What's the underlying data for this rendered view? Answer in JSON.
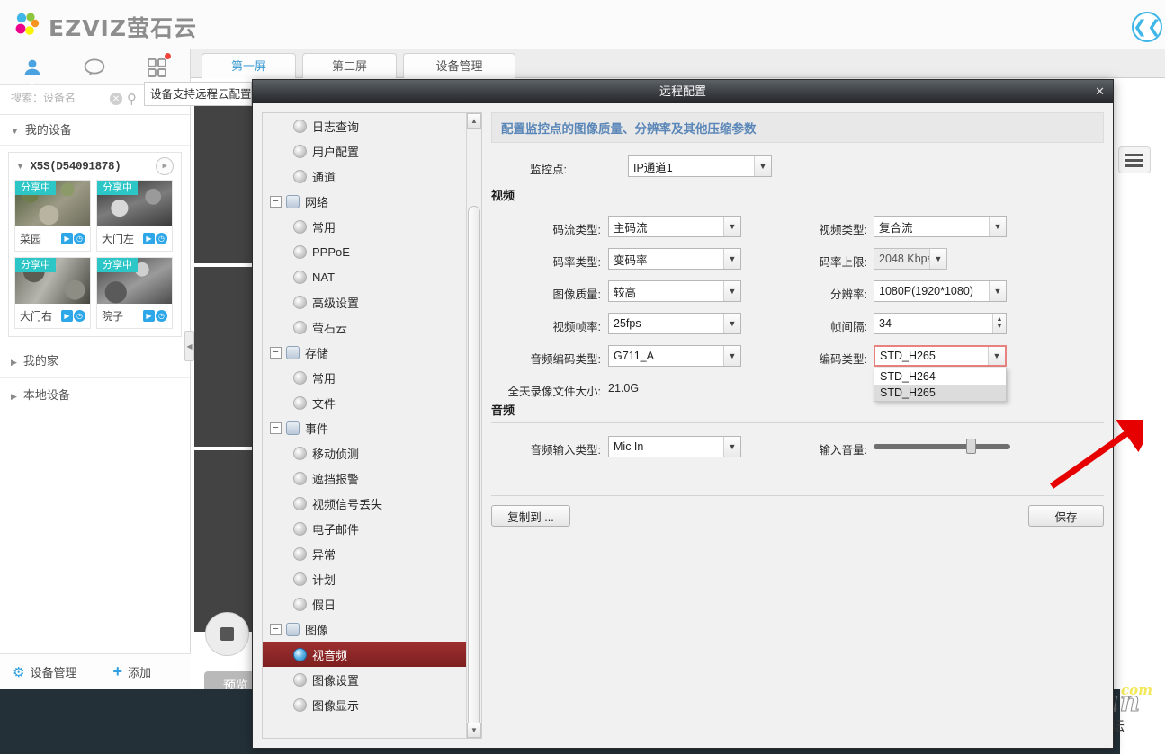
{
  "app": {
    "brand": "EZVIZ萤石云",
    "logo_icon": "ezviz-dots-logo",
    "topright_icon": "back-arrow-circle-icon"
  },
  "sidebar": {
    "icons": [
      {
        "name": "person-icon",
        "glyph": "♟"
      },
      {
        "name": "chat-icon",
        "glyph": "○"
      },
      {
        "name": "grid-icon",
        "glyph": "▣"
      }
    ],
    "search": {
      "placeholder": "搜索：设备名",
      "value": "",
      "clear_icon": "clear-icon",
      "search_icon": "search-icon"
    },
    "groups": [
      {
        "label": "我的设备",
        "expanded": true
      },
      {
        "label": "我的家",
        "expanded": false
      },
      {
        "label": "本地设备",
        "expanded": false
      }
    ],
    "device": {
      "name": "X5S(D54091878)",
      "play_icon": "play-icon",
      "cameras": [
        {
          "label": "菜园",
          "badge": "分享中"
        },
        {
          "label": "大门左",
          "badge": "分享中"
        },
        {
          "label": "大门右",
          "badge": "分享中"
        },
        {
          "label": "院子",
          "badge": "分享中"
        }
      ]
    },
    "bottom": {
      "manage_label": "设备管理",
      "manage_icon": "gear-icon",
      "add_label": "添加",
      "add_icon": "plus-icon"
    },
    "collapse_icon": "collapse-left-icon"
  },
  "tooltip": {
    "text": "设备支持远程云配置啦"
  },
  "tabs": [
    {
      "label": "第一屏",
      "active": true
    },
    {
      "label": "第二屏",
      "active": false
    },
    {
      "label": "设备管理",
      "active": false
    }
  ],
  "videowall": {
    "stop_icon": "stop-icon",
    "preview_label": "预览",
    "menu_icon": "hamburger-menu-icon"
  },
  "watermark": {
    "main": "Hassbian",
    "tld": "com",
    "sub": "瀚思彼岸技术论坛"
  },
  "dialog": {
    "title": "远程配置",
    "close_icon": "close-icon",
    "tree": [
      {
        "label": "日志查询",
        "level": 2,
        "icon": "gear-node-icon",
        "selected": false
      },
      {
        "label": "用户配置",
        "level": 2,
        "icon": "gear-node-icon",
        "selected": false
      },
      {
        "label": "通道",
        "level": 2,
        "icon": "gear-node-icon",
        "selected": false
      },
      {
        "label": "网络",
        "level": 1,
        "icon": "folder-node-icon",
        "selected": false,
        "toggle": "−"
      },
      {
        "label": "常用",
        "level": 2,
        "icon": "gear-node-icon",
        "selected": false
      },
      {
        "label": "PPPoE",
        "level": 2,
        "icon": "gear-node-icon",
        "selected": false
      },
      {
        "label": "NAT",
        "level": 2,
        "icon": "gear-node-icon",
        "selected": false
      },
      {
        "label": "高级设置",
        "level": 2,
        "icon": "gear-node-icon",
        "selected": false
      },
      {
        "label": "萤石云",
        "level": 2,
        "icon": "gear-node-icon",
        "selected": false
      },
      {
        "label": "存储",
        "level": 1,
        "icon": "folder-node-icon",
        "selected": false,
        "toggle": "−"
      },
      {
        "label": "常用",
        "level": 2,
        "icon": "gear-node-icon",
        "selected": false
      },
      {
        "label": "文件",
        "level": 2,
        "icon": "gear-node-icon",
        "selected": false
      },
      {
        "label": "事件",
        "level": 1,
        "icon": "folder-node-icon",
        "selected": false,
        "toggle": "−"
      },
      {
        "label": "移动侦测",
        "level": 2,
        "icon": "gear-node-icon",
        "selected": false
      },
      {
        "label": "遮挡报警",
        "level": 2,
        "icon": "gear-node-icon",
        "selected": false
      },
      {
        "label": "视频信号丢失",
        "level": 2,
        "icon": "gear-node-icon",
        "selected": false
      },
      {
        "label": "电子邮件",
        "level": 2,
        "icon": "gear-node-icon",
        "selected": false
      },
      {
        "label": "异常",
        "level": 2,
        "icon": "gear-node-icon",
        "selected": false
      },
      {
        "label": "计划",
        "level": 2,
        "icon": "gear-node-icon",
        "selected": false
      },
      {
        "label": "假日",
        "level": 2,
        "icon": "gear-node-icon",
        "selected": false
      },
      {
        "label": "图像",
        "level": 1,
        "icon": "folder-node-icon",
        "selected": false,
        "toggle": "−"
      },
      {
        "label": "视音频",
        "level": 2,
        "icon": "gear-node-icon",
        "selected": true
      },
      {
        "label": "图像设置",
        "level": 2,
        "icon": "gear-node-icon",
        "selected": false
      },
      {
        "label": "图像显示",
        "level": 2,
        "icon": "gear-node-icon",
        "selected": false
      }
    ],
    "pane_title": "配置监控点的图像质量、分辨率及其他压缩参数",
    "channel": {
      "label": "监控点:",
      "value": "IP通道1"
    },
    "video_section": "视频",
    "audio_section": "音频",
    "fields": {
      "stream_type": {
        "label": "码流类型:",
        "value": "主码流"
      },
      "video_type": {
        "label": "视频类型:",
        "value": "复合流"
      },
      "bitrate_type": {
        "label": "码率类型:",
        "value": "变码率"
      },
      "bitrate_cap": {
        "label": "码率上限:",
        "value": "2048 Kbps",
        "disabled": true
      },
      "image_quality": {
        "label": "图像质量:",
        "value": "较高"
      },
      "resolution": {
        "label": "分辨率:",
        "value": "1080P(1920*1080)"
      },
      "frame_rate": {
        "label": "视频帧率:",
        "value": "25fps"
      },
      "frame_gap": {
        "label": "帧间隔:",
        "value": "34"
      },
      "audio_codec": {
        "label": "音频编码类型:",
        "value": "G711_A"
      },
      "video_codec": {
        "label": "编码类型:",
        "value": "STD_H265",
        "highlighted": true
      },
      "audio_input": {
        "label": "音频输入类型:",
        "value": "Mic In"
      },
      "input_volume": {
        "label": "输入音量:",
        "value": 68
      }
    },
    "record_size": {
      "label": "全天录像文件大小:",
      "value": "21.0G"
    },
    "codec_dropdown": {
      "open": true,
      "options": [
        {
          "label": "STD_H264",
          "selected": false
        },
        {
          "label": "STD_H265",
          "selected": true
        }
      ]
    },
    "buttons": {
      "copy_to": "复制到 ...",
      "save": "保存"
    },
    "annotation_icon": "red-arrow-pointer"
  }
}
